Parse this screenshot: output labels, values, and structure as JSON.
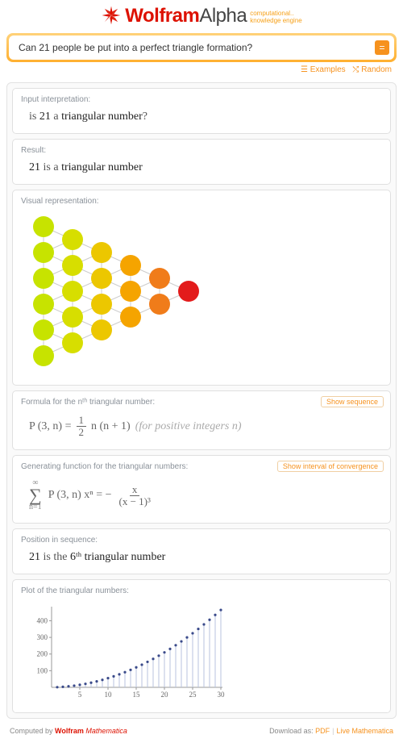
{
  "brand": {
    "part1": "Wolfram",
    "part2": "Alpha",
    "tagline1": "computational..",
    "tagline2": "knowledge engine"
  },
  "search": {
    "query": "Can 21 people be put into a perfect triangle formation?",
    "go": "="
  },
  "sublinks": {
    "examples": "Examples",
    "random": "Random"
  },
  "pods": {
    "interp": {
      "title": "Input interpretation:",
      "pre": "is ",
      "val": "21",
      "post": " a ",
      "term": "triangular number",
      "q": "?"
    },
    "result": {
      "title": "Result:",
      "val": "21",
      "is": " is a ",
      "term": "triangular number"
    },
    "visual": {
      "title": "Visual representation:"
    },
    "formula": {
      "title": "Formula for the nᵗʰ triangular number:",
      "action": "Show sequence",
      "lhs": "P (3, n) = ",
      "num": "1",
      "den": "2",
      "rhs": " n (n + 1)  ",
      "note": "(for positive integers n)"
    },
    "gf": {
      "title": "Generating function for the triangular numbers:",
      "action": "Show interval of convergence",
      "upper": "∞",
      "lower": "n=1",
      "body": "P (3, n) xⁿ = −",
      "numer": "x",
      "denom": "(x − 1)³"
    },
    "position": {
      "title": "Position in sequence:",
      "val": "21",
      "mid": " is the ",
      "ord": "6ᵗʰ",
      "term": " triangular number"
    },
    "plot": {
      "title": "Plot of the triangular numbers:"
    }
  },
  "chart_data": {
    "type": "scatter",
    "x": [
      1,
      2,
      3,
      4,
      5,
      6,
      7,
      8,
      9,
      10,
      11,
      12,
      13,
      14,
      15,
      16,
      17,
      18,
      19,
      20,
      21,
      22,
      23,
      24,
      25,
      26,
      27,
      28,
      29,
      30
    ],
    "values": [
      1,
      3,
      6,
      10,
      15,
      21,
      28,
      36,
      45,
      55,
      66,
      78,
      91,
      105,
      120,
      136,
      153,
      171,
      190,
      210,
      231,
      253,
      276,
      300,
      325,
      351,
      378,
      406,
      435,
      465
    ],
    "xticks": [
      5,
      10,
      15,
      20,
      25,
      30
    ],
    "yticks": [
      100,
      200,
      300,
      400
    ],
    "xlim": [
      0,
      30
    ],
    "ylim": [
      0,
      475
    ],
    "title": "Plot of the triangular numbers:"
  },
  "triangle_colors": [
    "#c7e300",
    "#c7e300",
    "#c7e300",
    "#c7e300",
    "#c7e300",
    "#c7e300",
    "#d7de00",
    "#d7de00",
    "#d7de00",
    "#d7de00",
    "#d7de00",
    "#ecc700",
    "#ecc700",
    "#ecc700",
    "#ecc700",
    "#f5a400",
    "#f5a400",
    "#f5a400",
    "#f07c1a",
    "#f07c1a",
    "#e31b1b"
  ],
  "footer": {
    "left_pre": "Computed by ",
    "left_link1": "Wolfram",
    "left_link2": "Mathematica",
    "right_pre": "Download as: ",
    "pdf": "PDF",
    "live": "Live Mathematica"
  }
}
